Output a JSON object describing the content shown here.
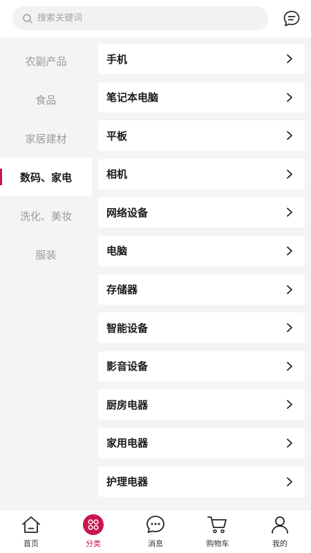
{
  "search": {
    "placeholder": "搜索关键词"
  },
  "icons": {
    "search": "search-icon",
    "message": "chat-bubble-icon",
    "chevron": "chevron-right-icon"
  },
  "colors": {
    "accent": "#c8164d",
    "background": "#f5f3f6"
  },
  "sidebar": {
    "items": [
      {
        "label": "农副产品",
        "active": false
      },
      {
        "label": "食品",
        "active": false
      },
      {
        "label": "家居建材",
        "active": false
      },
      {
        "label": "数码、家电",
        "active": true
      },
      {
        "label": "洗化、美妆",
        "active": false
      },
      {
        "label": "服装",
        "active": false
      }
    ]
  },
  "categories": {
    "items": [
      {
        "label": "手机"
      },
      {
        "label": "笔记本电脑"
      },
      {
        "label": "平板"
      },
      {
        "label": "相机"
      },
      {
        "label": "网络设备"
      },
      {
        "label": "电脑"
      },
      {
        "label": "存储器"
      },
      {
        "label": "智能设备"
      },
      {
        "label": "影音设备"
      },
      {
        "label": "厨房电器"
      },
      {
        "label": "家用电器"
      },
      {
        "label": "护理电器"
      }
    ]
  },
  "tabbar": {
    "items": [
      {
        "label": "首页",
        "icon": "home-icon",
        "active": false
      },
      {
        "label": "分类",
        "icon": "category-icon",
        "active": true
      },
      {
        "label": "消息",
        "icon": "message-icon",
        "active": false
      },
      {
        "label": "购物车",
        "icon": "cart-icon",
        "active": false
      },
      {
        "label": "我的",
        "icon": "profile-icon",
        "active": false
      }
    ]
  }
}
